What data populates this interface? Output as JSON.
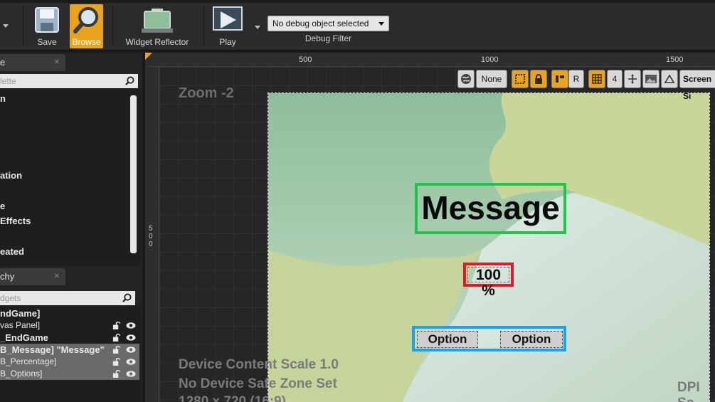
{
  "toolbar": {
    "save_label": "Save",
    "browse_label": "Browse",
    "reflector_label": "Widget Reflector",
    "play_label": "Play",
    "debug_select_value": "No debug object selected",
    "debug_filter_label": "Debug Filter"
  },
  "palette": {
    "tab_label": "e",
    "search_placeholder": "lette",
    "items": [
      "n",
      "ation",
      "e",
      "Effects",
      "eated"
    ]
  },
  "hierarchy": {
    "tab_label": "chy",
    "search_placeholder": "dgets",
    "rows": [
      {
        "label": "ndGame]"
      },
      {
        "label": "vas Panel]"
      },
      {
        "label": "_EndGame"
      },
      {
        "label": "B_Message] \"Message\""
      },
      {
        "label": "B_Percentage]"
      },
      {
        "label": "B_Options]"
      }
    ]
  },
  "designer": {
    "ruler_ticks": [
      "500",
      "1000",
      "1500"
    ],
    "ruler_v_label": [
      "5",
      "0",
      "0"
    ],
    "zoom": "Zoom -2",
    "toolbar": {
      "locale": "None",
      "r_label": "R",
      "grid_snap": "4",
      "screen_size": "Screen Si"
    },
    "message_text": "Message",
    "percentage_text": "100 %",
    "option_left": "Option",
    "option_right": "Option",
    "overlay_lines": [
      "Device Content Scale 1.0",
      "No Device Safe Zone Set",
      "1280 x 720 (16:9)"
    ],
    "dpi_text": "DPI Sc"
  },
  "colors": {
    "accent_orange": "#e9a31d",
    "message_outline": "#1fc44a",
    "percentage_outline": "#e5182b",
    "options_outline": "#1aa3e8"
  }
}
